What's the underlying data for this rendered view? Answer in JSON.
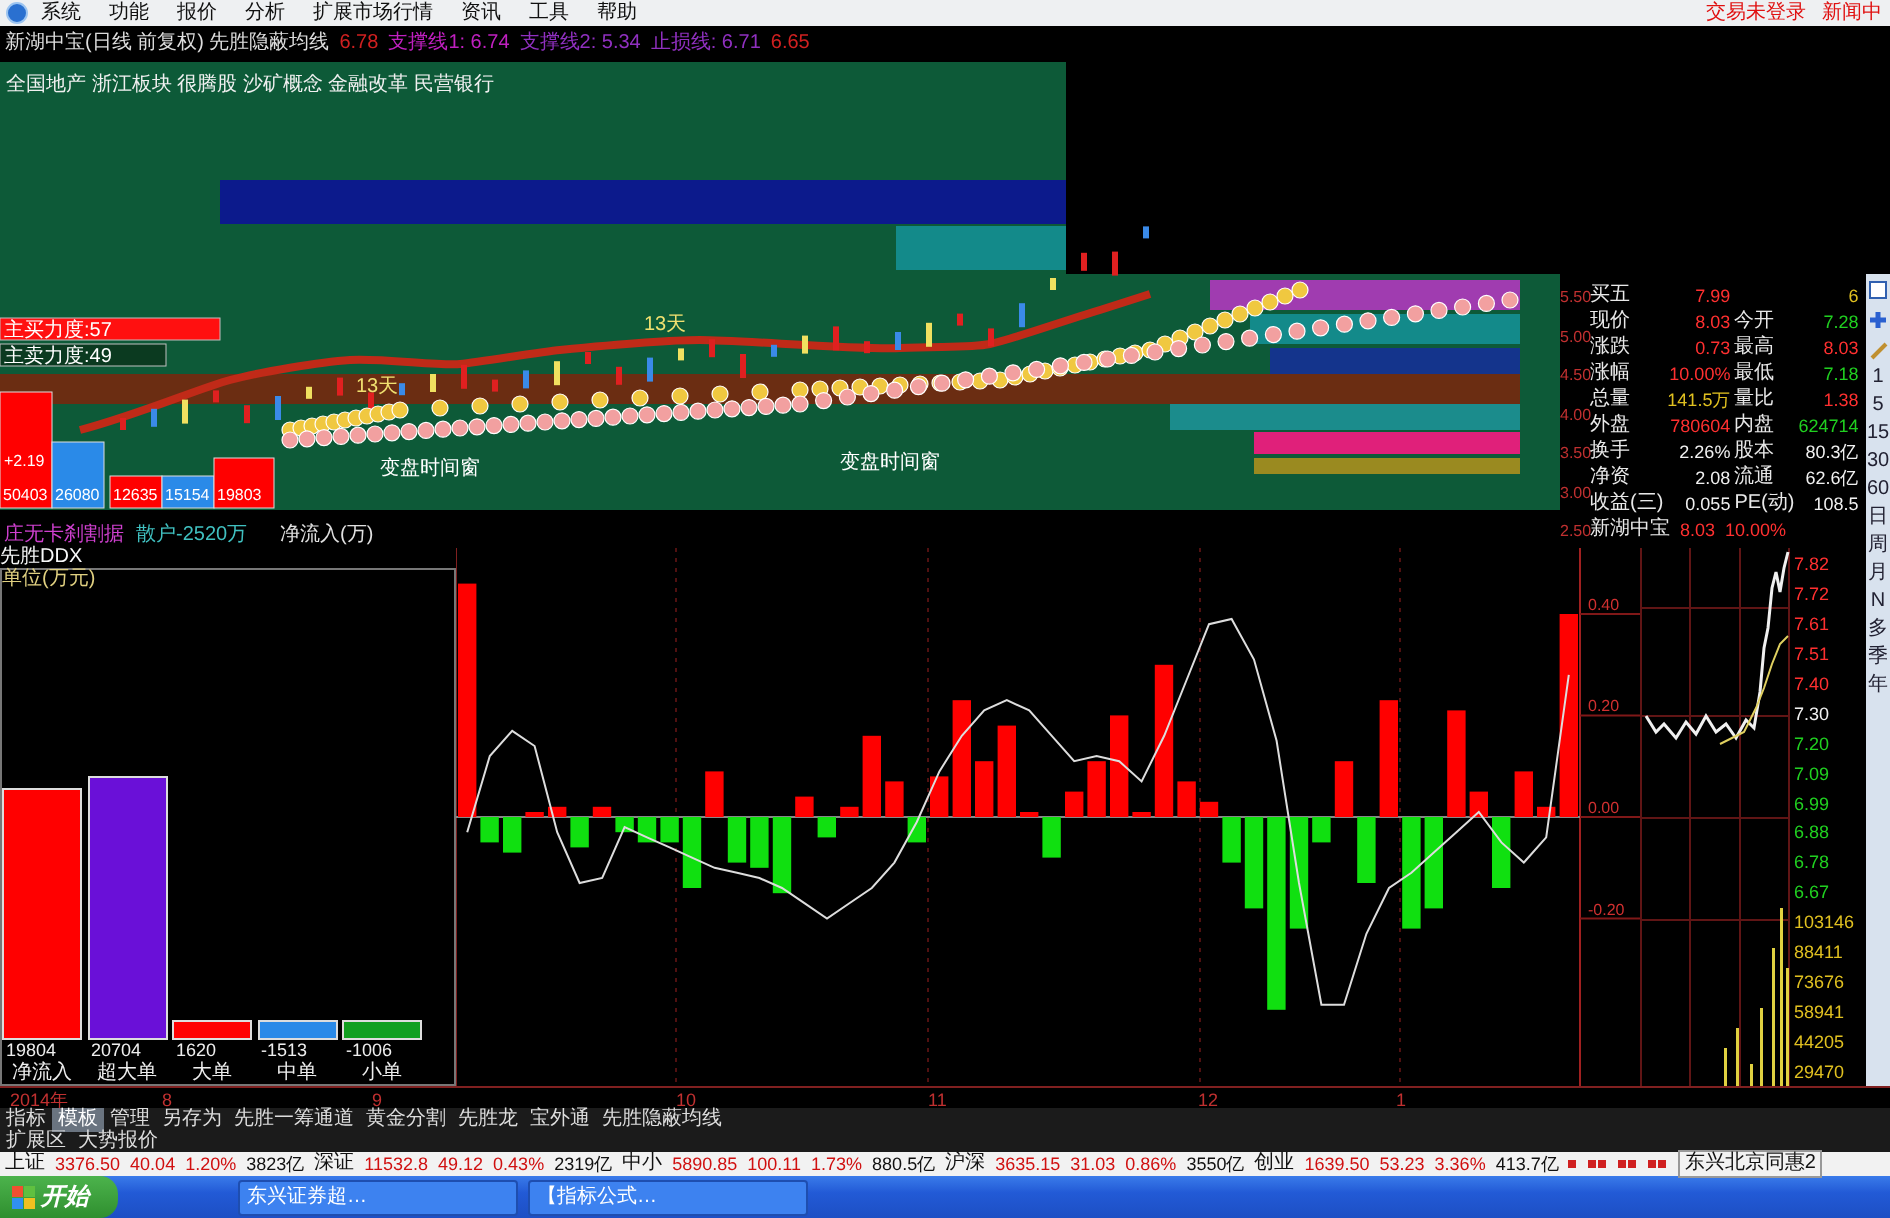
{
  "menu": {
    "items": [
      "系统",
      "功能",
      "报价",
      "分析",
      "扩展市场行情",
      "资讯",
      "工具",
      "帮助"
    ],
    "status": [
      "交易未登录",
      "新闻中"
    ]
  },
  "chart_title": {
    "text": "新湖中宝(日线 前复权) 先胜隐蔽均线",
    "indicators": [
      {
        "text": "6.78",
        "color": "#d02020"
      },
      {
        "text": "支撑线1: 6.74",
        "color": "#c020c0"
      },
      {
        "text": "支撑线2: 5.34",
        "color": "#9030c0"
      },
      {
        "text": "止损线: 6.71",
        "color": "#9030c0"
      },
      {
        "text": "6.65",
        "color": "#d02020"
      }
    ]
  },
  "upper_chart": {
    "sectors": "全国地产 浙江板块 很腾股 沙矿概念 金融改革 民营银行",
    "buy_strength": "主买力度:57",
    "sell_strength": "主卖力度:49",
    "change": "+2.19",
    "volume_boxes": [
      {
        "value": "50403",
        "color": "#ff0000"
      },
      {
        "value": "26080",
        "color": "#2a8ae8"
      },
      {
        "value": "12635",
        "color": "#ff0000"
      },
      {
        "value": "15154",
        "color": "#2a8ae8"
      },
      {
        "value": "19803",
        "color": "#ff0000"
      }
    ],
    "day_labels": [
      "13天",
      "13天"
    ],
    "window_labels": [
      "变盘时间窗",
      "变盘时间窗"
    ],
    "legend": [
      {
        "text": "庄无卡刹割据",
        "color": "#d040d0"
      },
      {
        "text": "散户-2520万",
        "color": "#40c0c0"
      },
      {
        "text": "净流入(万)",
        "color": "#e0e0e0"
      }
    ]
  },
  "quote": {
    "axis": [
      "5.50",
      "5.00",
      "4.50",
      "4.00",
      "3.50",
      "3.00",
      "2.50"
    ],
    "rows": [
      {
        "cells": [
          {
            "text": "买五",
            "kind": "label"
          },
          {
            "text": "7.99",
            "kind": "up"
          },
          {
            "text": "",
            "kind": "label"
          },
          {
            "text": "6",
            "kind": "volume"
          }
        ]
      },
      {
        "cells": [
          {
            "text": "现价",
            "kind": "label"
          },
          {
            "text": "8.03",
            "kind": "up"
          },
          {
            "text": "今开",
            "kind": "label"
          },
          {
            "text": "7.28",
            "kind": "down"
          }
        ]
      },
      {
        "cells": [
          {
            "text": "涨跌",
            "kind": "label"
          },
          {
            "text": "0.73",
            "kind": "up"
          },
          {
            "text": "最高",
            "kind": "label"
          },
          {
            "text": "8.03",
            "kind": "up"
          }
        ]
      },
      {
        "cells": [
          {
            "text": "涨幅",
            "kind": "label"
          },
          {
            "text": "10.00%",
            "kind": "up"
          },
          {
            "text": "最低",
            "kind": "label"
          },
          {
            "text": "7.18",
            "kind": "down"
          }
        ]
      },
      {
        "cells": [
          {
            "text": "总量",
            "kind": "label"
          },
          {
            "text": "141.5万",
            "kind": "volume"
          },
          {
            "text": "量比",
            "kind": "label"
          },
          {
            "text": "1.38",
            "kind": "up"
          }
        ]
      },
      {
        "cells": [
          {
            "text": "外盘",
            "kind": "label"
          },
          {
            "text": "780604",
            "kind": "up"
          },
          {
            "text": "内盘",
            "kind": "label"
          },
          {
            "text": "624714",
            "kind": "down"
          }
        ]
      },
      {
        "cells": [
          {
            "text": "换手",
            "kind": "label"
          },
          {
            "text": "2.26%",
            "kind": "flat"
          },
          {
            "text": "股本",
            "kind": "label"
          },
          {
            "text": "80.3亿",
            "kind": "flat"
          }
        ]
      },
      {
        "cells": [
          {
            "text": "净资",
            "kind": "label"
          },
          {
            "text": "2.08",
            "kind": "flat"
          },
          {
            "text": "流通",
            "kind": "label"
          },
          {
            "text": "62.6亿",
            "kind": "flat"
          }
        ]
      },
      {
        "cells": [
          {
            "text": "收益(三)",
            "kind": "label"
          },
          {
            "text": "0.055",
            "kind": "flat"
          },
          {
            "text": "PE(动)",
            "kind": "label"
          },
          {
            "text": "108.5",
            "kind": "flat"
          }
        ]
      },
      {
        "kind": "footer",
        "cells": [
          {
            "text": "新湖中宝",
            "kind": "label"
          },
          {
            "text": "8.03",
            "kind": "up"
          },
          {
            "text": "10.00%",
            "kind": "up"
          }
        ]
      }
    ]
  },
  "periods": [
    "1",
    "5",
    "15",
    "30",
    "60",
    "日",
    "周",
    "月",
    "N",
    "多",
    "季",
    "年"
  ],
  "flow": {
    "title": "先胜DDX",
    "unit": "单位(万元)",
    "bars": [
      {
        "label": "净流入",
        "value": "19804",
        "color": "#ff0000"
      },
      {
        "label": "超大单",
        "value": "20704",
        "color": "#6a10d8"
      },
      {
        "label": "大单",
        "value": "1620",
        "color": "#ff0000"
      },
      {
        "label": "中单",
        "value": "-1513",
        "color": "#2a8ae8"
      },
      {
        "label": "小单",
        "value": "-1006",
        "color": "#10a020"
      }
    ]
  },
  "ddx": {
    "chart_data": {
      "type": "bar",
      "ylim": [
        -0.53,
        0.53
      ],
      "yticks": [
        {
          "value": 0.4,
          "label": "0.40"
        },
        {
          "value": 0.2,
          "label": "0.20"
        },
        {
          "value": 0,
          "label": "0.00"
        },
        {
          "value": -0.2,
          "label": "-0.20"
        }
      ],
      "series": [
        {
          "values": [
            0.46,
            -0.05,
            -0.07,
            0.01,
            0.02,
            -0.06,
            0.02,
            -0.03,
            -0.05,
            -0.05,
            -0.14,
            0.09,
            -0.09,
            -0.1,
            -0.15,
            0.04,
            -0.04,
            0.02,
            0.16,
            0.07,
            -0.05,
            0.08,
            0.23,
            0.11,
            0.18,
            0.01,
            -0.08,
            0.05,
            0.11,
            0.2,
            0.01,
            0.3,
            0.07,
            0.03,
            -0.09,
            -0.18,
            -0.38,
            -0.22,
            -0.05,
            0.11,
            -0.13,
            0.23,
            -0.22,
            -0.18,
            0.21,
            0.05,
            -0.14,
            0.09,
            0.02,
            0.4
          ],
          "colors": [
            "#ff0000",
            "#10e010",
            "#10e010",
            "#ff0000",
            "#ff0000",
            "#10e010",
            "#ff0000",
            "#10e010",
            "#10e010",
            "#10e010",
            "#10e010",
            "#ff0000",
            "#10e010",
            "#10e010",
            "#10e010",
            "#ff0000",
            "#10e010",
            "#ff0000",
            "#ff0000",
            "#ff0000",
            "#10e010",
            "#ff0000",
            "#ff0000",
            "#ff0000",
            "#ff0000",
            "#ff0000",
            "#10e010",
            "#ff0000",
            "#ff0000",
            "#ff0000",
            "#ff0000",
            "#ff0000",
            "#ff0000",
            "#ff0000",
            "#10e010",
            "#10e010",
            "#10e010",
            "#10e010",
            "#10e010",
            "#ff0000",
            "#10e010",
            "#ff0000",
            "#10e010",
            "#10e010",
            "#ff0000",
            "#ff0000",
            "#10e010",
            "#ff0000",
            "#ff0000",
            "#ff0000"
          ]
        },
        {
          "type": "line",
          "color": "#dddddd",
          "values": [
            -0.03,
            0.12,
            0.17,
            0.14,
            -0.03,
            -0.13,
            -0.12,
            -0.02,
            -0.04,
            -0.06,
            -0.08,
            -0.1,
            -0.11,
            -0.12,
            -0.14,
            -0.17,
            -0.2,
            -0.17,
            -0.14,
            -0.09,
            -0.01,
            0.09,
            0.16,
            0.21,
            0.23,
            0.21,
            0.16,
            0.11,
            0.12,
            0.11,
            0.07,
            0.16,
            0.27,
            0.38,
            0.39,
            0.31,
            0.15,
            -0.13,
            -0.37,
            -0.37,
            -0.23,
            -0.14,
            -0.11,
            -0.07,
            -0.03,
            0.01,
            -0.05,
            -0.09,
            -0.04,
            0.28
          ]
        }
      ]
    }
  },
  "price_axis": [
    {
      "text": "7.82",
      "kind": "up"
    },
    {
      "text": "7.72",
      "kind": "up"
    },
    {
      "text": "7.61",
      "kind": "up"
    },
    {
      "text": "7.51",
      "kind": "up"
    },
    {
      "text": "7.40",
      "kind": "up"
    },
    {
      "text": "7.30",
      "kind": "flat"
    },
    {
      "text": "7.20",
      "kind": "down"
    },
    {
      "text": "7.09",
      "kind": "down"
    },
    {
      "text": "6.99",
      "kind": "down"
    },
    {
      "text": "6.88",
      "kind": "down"
    },
    {
      "text": "6.78",
      "kind": "down"
    },
    {
      "text": "6.67",
      "kind": "down"
    },
    {
      "text": "103146",
      "kind": "volume"
    },
    {
      "text": "88411",
      "kind": "volume"
    },
    {
      "text": "73676",
      "kind": "volume"
    },
    {
      "text": "58941",
      "kind": "volume"
    },
    {
      "text": "44205",
      "kind": "volume"
    },
    {
      "text": "29470",
      "kind": "volume"
    }
  ],
  "date_axis": [
    "2014年",
    "8",
    "9",
    "10",
    "11",
    "12",
    "1"
  ],
  "tabs": [
    {
      "label": "指标",
      "selected": false
    },
    {
      "label": "模板",
      "selected": true
    },
    {
      "label": "管理",
      "selected": false
    },
    {
      "label": "另存为",
      "selected": false
    },
    {
      "label": "先胜一筹通道",
      "selected": false
    },
    {
      "label": "黄金分割",
      "selected": false
    },
    {
      "label": "先胜龙",
      "selected": false
    },
    {
      "label": "宝外通",
      "selected": false
    },
    {
      "label": "先胜隐蔽均线",
      "selected": false
    }
  ],
  "extension": [
    "扩展区",
    "大势报价"
  ],
  "ticker": {
    "indices": [
      {
        "name": "上证",
        "value": "3376.50",
        "change": "40.04",
        "percent": "1.20%",
        "amount": "3823亿"
      },
      {
        "name": "深证",
        "value": "11532.8",
        "change": "49.12",
        "percent": "0.43%",
        "amount": "2319亿"
      },
      {
        "name": "中小",
        "value": "5890.85",
        "change": "100.11",
        "percent": "1.73%",
        "amount": "880.5亿"
      },
      {
        "name": "沪深",
        "value": "3635.15",
        "change": "31.03",
        "percent": "0.86%",
        "amount": "3550亿"
      },
      {
        "name": "创业",
        "value": "1639.50",
        "change": "53.23",
        "percent": "3.36%",
        "amount": "413.7亿"
      }
    ],
    "broker": "东兴北京同惠2"
  },
  "taskbar": {
    "start": "开始",
    "tasks": [
      "东兴证券超…",
      "【指标公式…"
    ]
  }
}
